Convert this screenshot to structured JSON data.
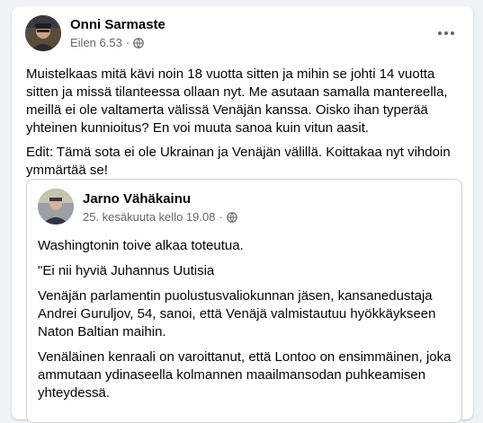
{
  "post": {
    "author": "Onni Sarmaste",
    "time": "Eilen 6.53",
    "separator": "·",
    "privacy_icon": "globe-icon",
    "more_icon": "more-options-icon",
    "paragraphs": [
      "Muistelkaas mitä kävi noin 18 vuotta sitten ja mihin se johti 14 vuotta sitten ja missä tilanteessa ollaan nyt. Me asutaan samalla mantereella, meillä ei ole valtamerta välissä Venäjän kanssa. Oisko ihan typerää yhteinen kunnioitus? En voi muuta sanoa kuin vitun aasit.",
      "Edit: Tämä sota ei ole Ukrainan ja Venäjän välillä. Koittakaa nyt vihdoin ymmärtää se!"
    ]
  },
  "shared_post": {
    "author": "Jarno Vähäkainu",
    "time": "25. kesäkuuta kello 19.08",
    "separator": "·",
    "privacy_icon": "globe-icon",
    "paragraphs": [
      "Washingtonin toive alkaa toteutua.",
      "\"Ei nii hyviä Juhannus Uutisia",
      "Venäjän parlamentin puolustusvaliokunnan jäsen, kansanedustaja Andrei Guruljov, 54, sanoi, että Venäjä valmistautuu hyökkäykseen Naton Baltian maihin.",
      "Venäläinen kenraali on varoittanut, että Lontoo on ensimmäinen, joka ammutaan ydinaseella kolmannen maailmansodan puhkeamisen yhteydessä."
    ]
  },
  "colors": {
    "background": "#f0f2f5",
    "card": "#ffffff",
    "text_primary": "#050505",
    "text_secondary": "#65676b",
    "border": "#ced0d4"
  }
}
